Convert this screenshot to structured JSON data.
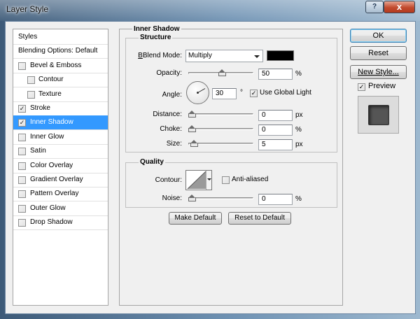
{
  "window": {
    "title": "Layer Style",
    "help_glyph": "?",
    "close_glyph": "x"
  },
  "styles_list": [
    {
      "label": "Styles",
      "kind": "head",
      "checked": false
    },
    {
      "label": "Blending Options: Default",
      "kind": "head",
      "checked": false
    },
    {
      "label": "Bevel & Emboss",
      "kind": "item",
      "checked": false
    },
    {
      "label": "Contour",
      "kind": "sub",
      "checked": false
    },
    {
      "label": "Texture",
      "kind": "sub",
      "checked": false
    },
    {
      "label": "Stroke",
      "kind": "item",
      "checked": true
    },
    {
      "label": "Inner Shadow",
      "kind": "item",
      "checked": true,
      "selected": true
    },
    {
      "label": "Inner Glow",
      "kind": "item",
      "checked": false
    },
    {
      "label": "Satin",
      "kind": "item",
      "checked": false
    },
    {
      "label": "Color Overlay",
      "kind": "item",
      "checked": false
    },
    {
      "label": "Gradient Overlay",
      "kind": "item",
      "checked": false
    },
    {
      "label": "Pattern Overlay",
      "kind": "item",
      "checked": false
    },
    {
      "label": "Outer Glow",
      "kind": "item",
      "checked": false
    },
    {
      "label": "Drop Shadow",
      "kind": "item",
      "checked": false
    }
  ],
  "panel": {
    "title": "Inner Shadow",
    "structure": {
      "title": "Structure",
      "blend_mode_label": "Blend Mode:",
      "blend_mode_value": "Multiply",
      "shadow_color": "#000000",
      "opacity_label": "Opacity:",
      "opacity_value": "50",
      "opacity_unit": "%",
      "opacity_level": 0.5,
      "angle_label": "Angle:",
      "angle_value": "30",
      "angle_unit": "°",
      "use_global_light_label": "Use Global Light",
      "use_global_light_checked": true,
      "distance_label": "Distance:",
      "distance_value": "0",
      "distance_unit": "px",
      "distance_level": 0.0,
      "choke_label": "Choke:",
      "choke_value": "0",
      "choke_unit": "%",
      "choke_level": 0.0,
      "size_label": "Size:",
      "size_value": "5",
      "size_unit": "px",
      "size_level": 0.04
    },
    "quality": {
      "title": "Quality",
      "contour_label": "Contour:",
      "anti_aliased_label": "Anti-aliased",
      "anti_aliased_checked": false,
      "noise_label": "Noise:",
      "noise_value": "0",
      "noise_unit": "%",
      "noise_level": 0.0
    },
    "make_default_label": "Make Default",
    "reset_default_label": "Reset to Default"
  },
  "side": {
    "ok_label": "OK",
    "reset_label": "Reset",
    "new_style_label": "New Style...",
    "preview_label": "Preview",
    "preview_checked": true
  }
}
